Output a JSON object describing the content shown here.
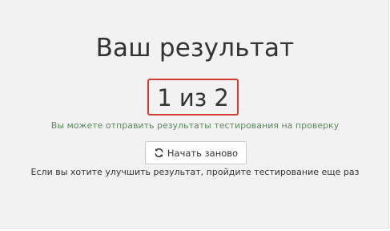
{
  "result": {
    "title": "Ваш результат",
    "score": "1 из 2",
    "send_hint": "Вы можете отправить результаты тестирования на проверку",
    "restart_button_label": "Начать заново",
    "restart_icon": "refresh-icon",
    "improve_hint": "Если вы хотите улучшить результат, пройдите тестирование еще раз"
  },
  "colors": {
    "highlight_border": "#d43c2f",
    "hint_green": "#5d8a5e",
    "background": "#f2f2f2"
  }
}
